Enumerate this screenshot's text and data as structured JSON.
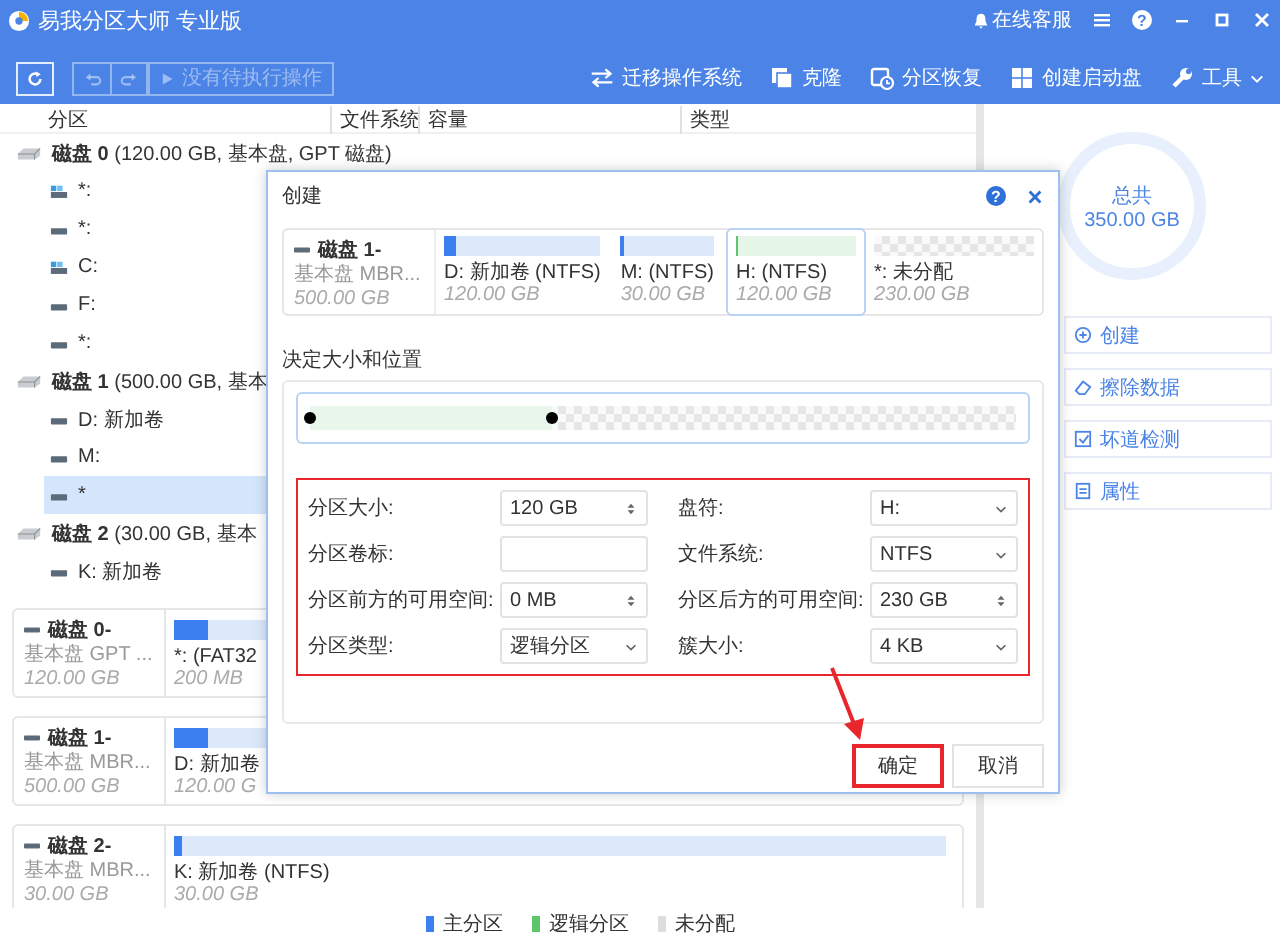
{
  "window": {
    "title": "易我分区大师 专业版",
    "controls": [
      {
        "kind": "support",
        "label": "在线客服"
      },
      {
        "kind": "menu"
      },
      {
        "kind": "help",
        "label": "?"
      },
      {
        "kind": "minimize"
      },
      {
        "kind": "maximize"
      },
      {
        "kind": "close"
      }
    ]
  },
  "toolbar": {
    "left": [
      {
        "kind": "refresh",
        "disabled": false
      },
      {
        "kind": "undo",
        "disabled": true
      },
      {
        "kind": "redo",
        "disabled": true
      },
      {
        "kind": "pending",
        "label": "没有待执行操作",
        "disabled": true
      }
    ],
    "right": [
      {
        "kind": "migrate",
        "label": "迁移操作系统"
      },
      {
        "kind": "clone",
        "label": "克隆"
      },
      {
        "kind": "recover",
        "label": "分区恢复"
      },
      {
        "kind": "bootdisk",
        "label": "创建启动盘"
      },
      {
        "kind": "tools",
        "label": "工具"
      }
    ]
  },
  "table": {
    "columns": [
      "分区",
      "文件系统",
      "容量",
      "类型"
    ]
  },
  "tree": [
    {
      "label": "**磁盘 0** (120.00 GB, 基本盘, GPT 磁盘)",
      "children": [
        {
          "label": "*:",
          "kind": "system",
          "selected": false
        },
        {
          "label": "*:",
          "kind": "drive",
          "selected": false
        },
        {
          "label": "C:",
          "kind": "system",
          "selected": false
        },
        {
          "label": "F:",
          "kind": "drive",
          "selected": false
        },
        {
          "label": "*:",
          "kind": "drive",
          "selected": false
        }
      ]
    },
    {
      "label": "**磁盘 1** (500.00 GB, 基本",
      "children": [
        {
          "label": "D: 新加卷",
          "kind": "drive",
          "selected": false
        },
        {
          "label": "M:",
          "kind": "drive",
          "selected": false
        },
        {
          "label": "*",
          "kind": "drive",
          "selected": true
        }
      ]
    },
    {
      "label": "**磁盘 2** (30.00 GB, 基本",
      "children": [
        {
          "label": "K: 新加卷",
          "kind": "drive",
          "selected": false
        }
      ]
    }
  ],
  "disk_cards": [
    {
      "name": "磁盘 0-",
      "type": "基本盘 GPT ...",
      "size": "120.00 GB",
      "partitions": [
        {
          "label": "*: (FAT32",
          "size": "200 MB",
          "kind": "primary",
          "level": 0.3,
          "wide": false
        }
      ]
    },
    {
      "name": "磁盘 1-",
      "type": "基本盘 MBR...",
      "size": "500.00 GB",
      "partitions": [
        {
          "label": "D: 新加卷",
          "size": "120.00 G",
          "kind": "primary",
          "level": 0.3,
          "wide": false
        }
      ]
    },
    {
      "name": "磁盘 2-",
      "type": "基本盘 MBR...",
      "size": "30.00 GB",
      "partitions": [
        {
          "label": "K: 新加卷 (NTFS)",
          "size": "30.00 GB",
          "kind": "primary",
          "level": 0.01,
          "wide": true
        }
      ]
    }
  ],
  "side_panel": {
    "total_label": "总共",
    "total_value": "350.00 GB",
    "actions": [
      {
        "kind": "create",
        "label": "创建"
      },
      {
        "kind": "wipe",
        "label": "擦除数据"
      },
      {
        "kind": "check",
        "label": "坏道检测"
      },
      {
        "kind": "properties",
        "label": "属性"
      }
    ]
  },
  "legend": [
    {
      "label": "主分区",
      "color": "#3b7ff0"
    },
    {
      "label": "逻辑分区",
      "color": "#5cc66c"
    },
    {
      "label": "未分配",
      "color": "#dddddd"
    }
  ],
  "dialog": {
    "title": "创建",
    "help": "?",
    "disk": {
      "name": "磁盘 1-",
      "type": "基本盘 MBR...",
      "size": "500.00 GB"
    },
    "partitions": [
      {
        "label": "D: 新加卷 (NTFS)",
        "size": "120.00 GB",
        "kind": "primary",
        "level": 0.08,
        "selected": false
      },
      {
        "label": "M:  (NTFS)",
        "size": "30.00 GB",
        "kind": "primary",
        "level": 0.03,
        "selected": false
      },
      {
        "label": "H:  (NTFS)",
        "size": "120.00 GB",
        "kind": "logical",
        "level": 0.01,
        "selected": true
      },
      {
        "label": "*: 未分配",
        "size": "230.00 GB",
        "kind": "unallocated",
        "selected": false
      }
    ],
    "section": "决定大小和位置",
    "slider": {
      "level": 0.343
    },
    "form": {
      "highlighted": true,
      "fields": [
        {
          "label": "分区大小:",
          "kind": "spin",
          "value": "120 GB"
        },
        {
          "label": "盘符:",
          "kind": "select",
          "value": "H:"
        },
        {
          "label": "分区卷标:",
          "kind": "text"
        },
        {
          "label": "文件系统:",
          "kind": "select",
          "value": "NTFS"
        },
        {
          "label": "分区前方的可用空间:",
          "kind": "spin",
          "value": "0 MB"
        },
        {
          "label": "分区后方的可用空间:",
          "kind": "spin",
          "value": "230 GB"
        },
        {
          "label": "分区类型:",
          "kind": "select",
          "value": "逻辑分区"
        },
        {
          "label": "簇大小:",
          "kind": "select",
          "value": "4 KB"
        }
      ]
    },
    "buttons": [
      {
        "label": "确定",
        "highlighted": true
      },
      {
        "label": "取消",
        "highlighted": false
      }
    ]
  }
}
